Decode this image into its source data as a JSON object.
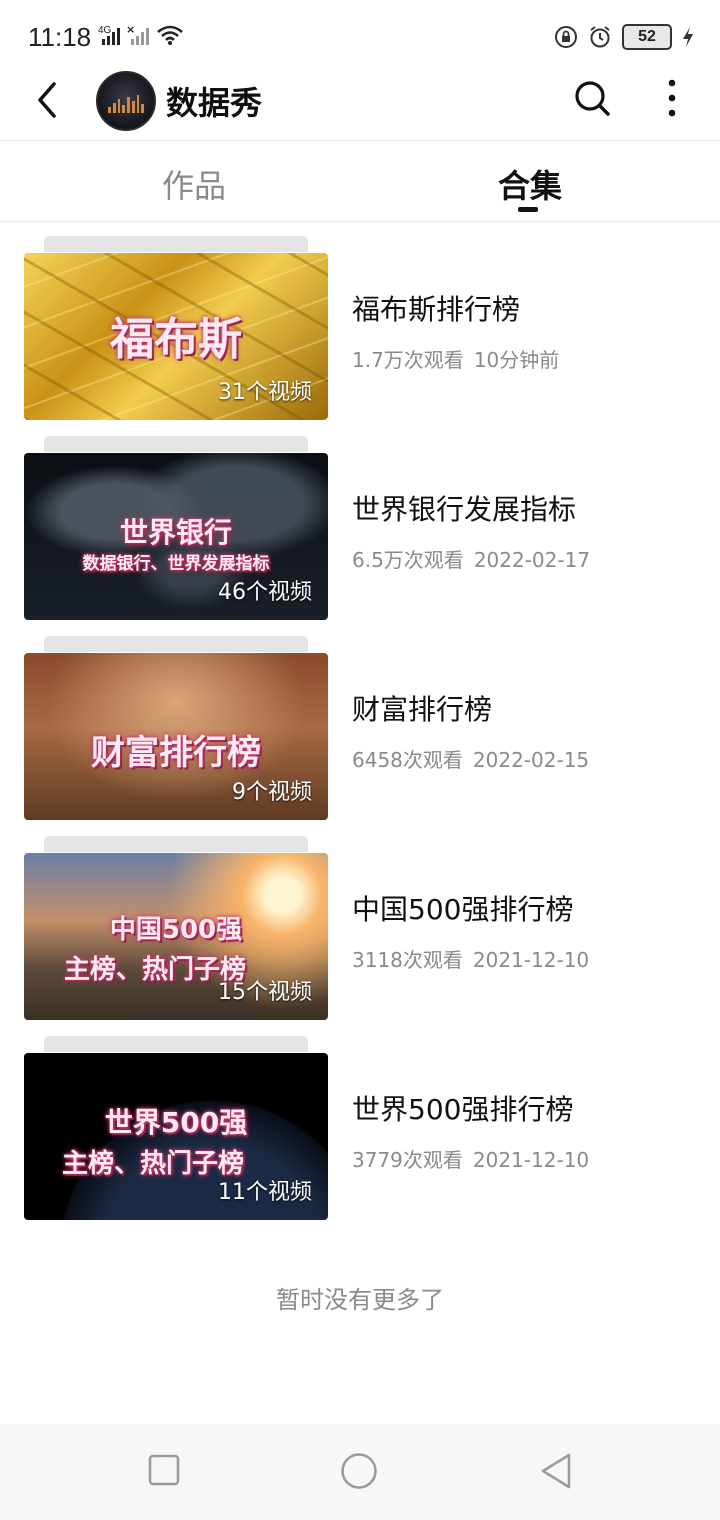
{
  "status_bar": {
    "time": "11:18",
    "network": "4G",
    "battery": "52"
  },
  "header": {
    "channel_name": "数据秀"
  },
  "tabs": [
    {
      "label": "作品",
      "active": false
    },
    {
      "label": "合集",
      "active": true
    }
  ],
  "collections": [
    {
      "title": "福布斯排行榜",
      "views": "1.7万次观看",
      "time": "10分钟前",
      "video_count": "31个视频",
      "thumb_lines": [
        "福布斯"
      ],
      "thumb_theme": "gold"
    },
    {
      "title": "世界银行发展指标",
      "views": "6.5万次观看",
      "time": "2022-02-17",
      "video_count": "46个视频",
      "thumb_lines": [
        "世界银行",
        "数据银行、世界发展指标"
      ],
      "thumb_theme": "world-map"
    },
    {
      "title": "财富排行榜",
      "views": "6458次观看",
      "time": "2022-02-15",
      "video_count": "9个视频",
      "thumb_lines": [
        "财富排行榜"
      ],
      "thumb_theme": "coins"
    },
    {
      "title": "中国500强排行榜",
      "views": "3118次观看",
      "time": "2021-12-10",
      "video_count": "15个视频",
      "thumb_lines": [
        "中国500强",
        "主榜、热门子榜"
      ],
      "thumb_theme": "great-wall"
    },
    {
      "title": "世界500强排行榜",
      "views": "3779次观看",
      "time": "2021-12-10",
      "video_count": "11个视频",
      "thumb_lines": [
        "世界500强",
        "主榜、热门子榜"
      ],
      "thumb_theme": "earth"
    }
  ],
  "end_message": "暂时没有更多了",
  "colors": {
    "text_primary": "#111111",
    "text_secondary": "#8a8a8a",
    "background": "#ffffff",
    "nav_bar": "#f7f7f7"
  },
  "icons": [
    "back-arrow-icon",
    "search-icon",
    "more-vertical-icon",
    "square-nav-icon",
    "circle-nav-icon",
    "triangle-back-nav-icon"
  ]
}
